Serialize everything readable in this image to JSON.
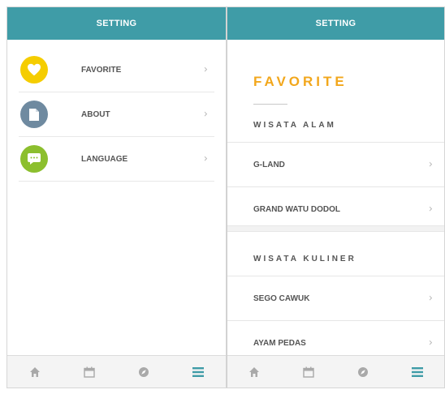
{
  "colors": {
    "header": "#3f9ca7",
    "accent_orange": "#f2a71c",
    "favorite_circle": "#f5cd00",
    "about_circle": "#6f8aa0",
    "language_circle": "#8cbf2e",
    "nav_inactive": "#a9a9a9",
    "nav_active": "#3f9ca7"
  },
  "left": {
    "header_title": "SETTING",
    "menu": [
      {
        "label": "FAVORITE",
        "icon": "heart-icon"
      },
      {
        "label": "ABOUT",
        "icon": "document-icon"
      },
      {
        "label": "LANGUAGE",
        "icon": "chat-bubble-icon"
      }
    ]
  },
  "right": {
    "header_title": "SETTING",
    "title": "FAVORITE",
    "sections": [
      {
        "heading": "WISATA ALAM",
        "items": [
          "G-LAND",
          "GRAND WATU DODOL"
        ]
      },
      {
        "heading": "WISATA KULINER",
        "items": [
          "SEGO CAWUK",
          "AYAM PEDAS"
        ]
      }
    ]
  },
  "bottom_nav": {
    "items": [
      "home-icon",
      "calendar-icon",
      "compass-icon",
      "menu-icon"
    ],
    "active_index": 3
  }
}
